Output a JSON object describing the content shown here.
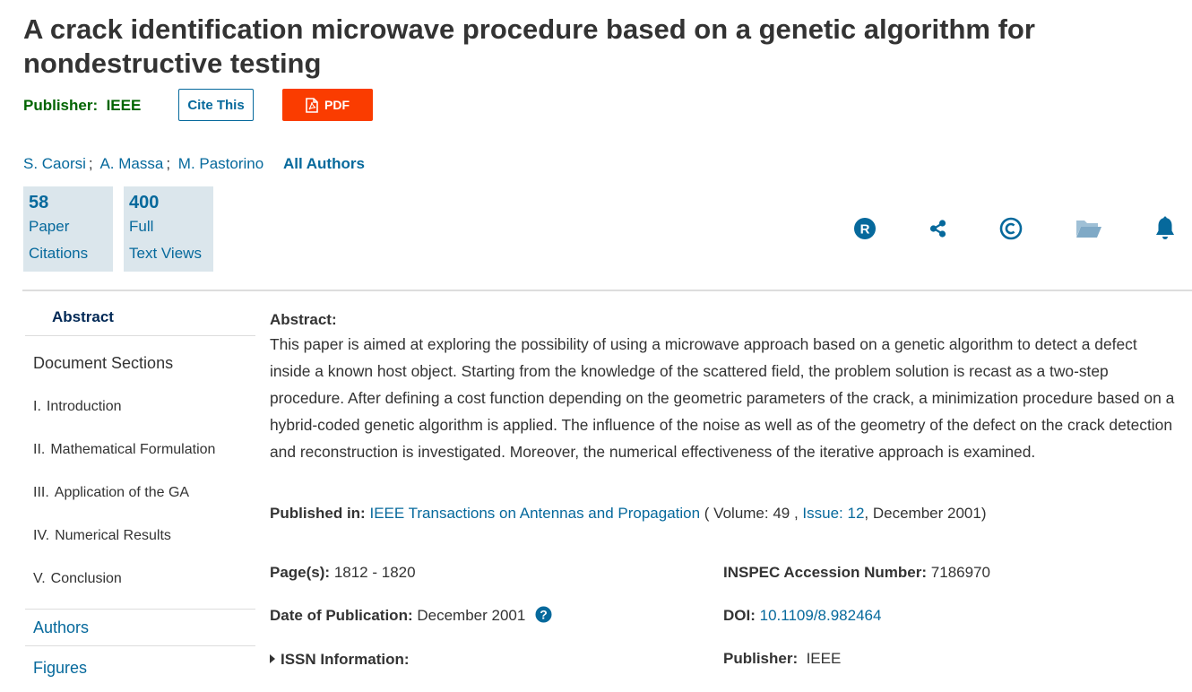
{
  "title": "A crack identification microwave procedure based on a genetic algorithm for nondestructive testing",
  "publisher_label": "Publisher:",
  "publisher_value": "IEEE",
  "cite_label": "Cite This",
  "pdf_label": "PDF",
  "authors": [
    "S. Caorsi",
    "A. Massa",
    "M. Pastorino"
  ],
  "author_sep": ";",
  "all_authors_label": "All Authors",
  "metrics": [
    {
      "value": "58",
      "line1": "Paper",
      "line2": "Citations"
    },
    {
      "value": "400",
      "line1": "Full",
      "line2": "Text Views"
    }
  ],
  "action_icons": [
    "rights-r-icon",
    "share-icon",
    "copyright-icon",
    "folder-icon",
    "bell-icon"
  ],
  "nav": {
    "abstract": "Abstract",
    "document_sections": "Document Sections",
    "sections": [
      {
        "roman": "I.",
        "label": "Introduction"
      },
      {
        "roman": "II.",
        "label": "Mathematical Formulation"
      },
      {
        "roman": "III.",
        "label": "Application of the GA"
      },
      {
        "roman": "IV.",
        "label": "Numerical Results"
      },
      {
        "roman": "V.",
        "label": "Conclusion"
      }
    ],
    "authors": "Authors",
    "figures": "Figures"
  },
  "abstract": {
    "label": "Abstract:",
    "text": "This paper is aimed at exploring the possibility of using a microwave approach based on a genetic algorithm to detect a defect inside a known host object. Starting from the knowledge of the scattered field, the problem solution is recast as a two-step procedure. After defining a cost function depending on the geometric parameters of the crack, a minimization procedure based on a hybrid-coded genetic algorithm is applied. The influence of the noise as well as of the geometry of the defect on the crack detection and reconstruction is investigated. Moreover, the numerical effectiveness of the iterative approach is examined."
  },
  "published_in": {
    "label": "Published in:",
    "journal": "IEEE Transactions on Antennas and Propagation",
    "open": "( Volume: 49 ,",
    "issue": "Issue: 12",
    "close": ", December 2001)"
  },
  "pages": {
    "label": "Page(s):",
    "value": "1812 - 1820"
  },
  "inspec": {
    "label": "INSPEC Accession Number:",
    "value": "7186970"
  },
  "date_pub": {
    "label": "Date of Publication:",
    "value": "December 2001"
  },
  "doi": {
    "label": "DOI:",
    "value": "10.1109/8.982464"
  },
  "issn": {
    "label": "ISSN Information:"
  },
  "publisher_meta": {
    "label": "Publisher:",
    "value": "IEEE"
  },
  "colors": {
    "link": "#06699c",
    "publisher": "#006400",
    "pdf": "#fa3c00",
    "metric_bg": "#dbe6ec",
    "nav_active": "#002855"
  }
}
